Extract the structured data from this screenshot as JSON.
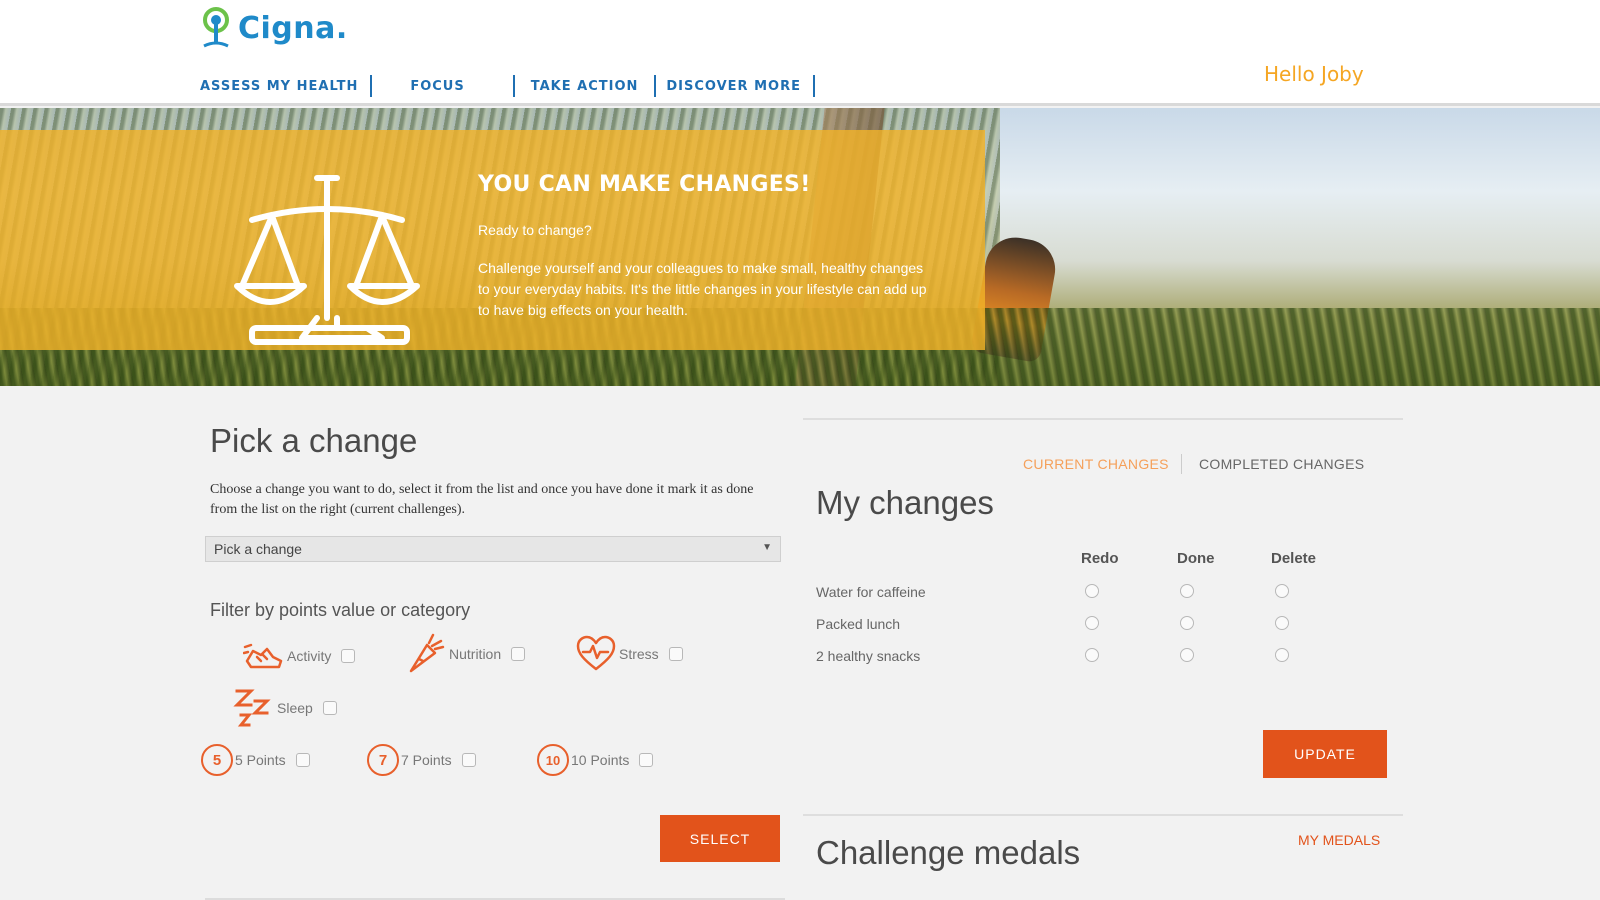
{
  "header": {
    "logo_text": "Cigna.",
    "nav": [
      {
        "label": "ASSESS MY HEALTH"
      },
      {
        "label": "FOCUS"
      },
      {
        "label": "TAKE ACTION"
      },
      {
        "label": "DISCOVER MORE"
      }
    ],
    "greeting": "Hello Joby"
  },
  "hero": {
    "title": "YOU CAN MAKE CHANGES!",
    "subtitle": "Ready to change?",
    "body": "Challenge yourself and your colleagues to make small, healthy changes to your everyday habits. It's the little changes in your lifestyle can add up to have big effects on your health."
  },
  "pick": {
    "heading": "Pick a change",
    "description": "Choose a change you want to do, select it from the list and once you have done it mark it as done from the list on the right (current challenges).",
    "select_value": "Pick a change",
    "filter_title": "Filter by points value or category",
    "categories": [
      {
        "label": "Activity",
        "icon": "running-shoe-icon"
      },
      {
        "label": "Nutrition",
        "icon": "carrot-icon"
      },
      {
        "label": "Stress",
        "icon": "heart-pulse-icon"
      },
      {
        "label": "Sleep",
        "icon": "zzz-icon"
      }
    ],
    "points": [
      {
        "badge": "5",
        "label": "5 Points"
      },
      {
        "badge": "7",
        "label": "7 Points"
      },
      {
        "badge": "10",
        "label": "10 Points"
      }
    ],
    "select_button": "SELECT"
  },
  "my_changes": {
    "tabs": {
      "current": "CURRENT CHANGES",
      "completed": "COMPLETED CHANGES"
    },
    "heading": "My changes",
    "columns": [
      "Redo",
      "Done",
      "Delete"
    ],
    "rows": [
      "Water for caffeine",
      "Packed lunch",
      "2 healthy snacks"
    ],
    "update_button": "UPDATE"
  },
  "medals": {
    "heading": "Challenge medals",
    "link": "MY MEDALS"
  },
  "colors": {
    "brand_blue": "#1f6fb2",
    "accent_orange": "#e2531b",
    "hero_yellow": "#f2b228",
    "greeting_orange": "#f5a623"
  }
}
